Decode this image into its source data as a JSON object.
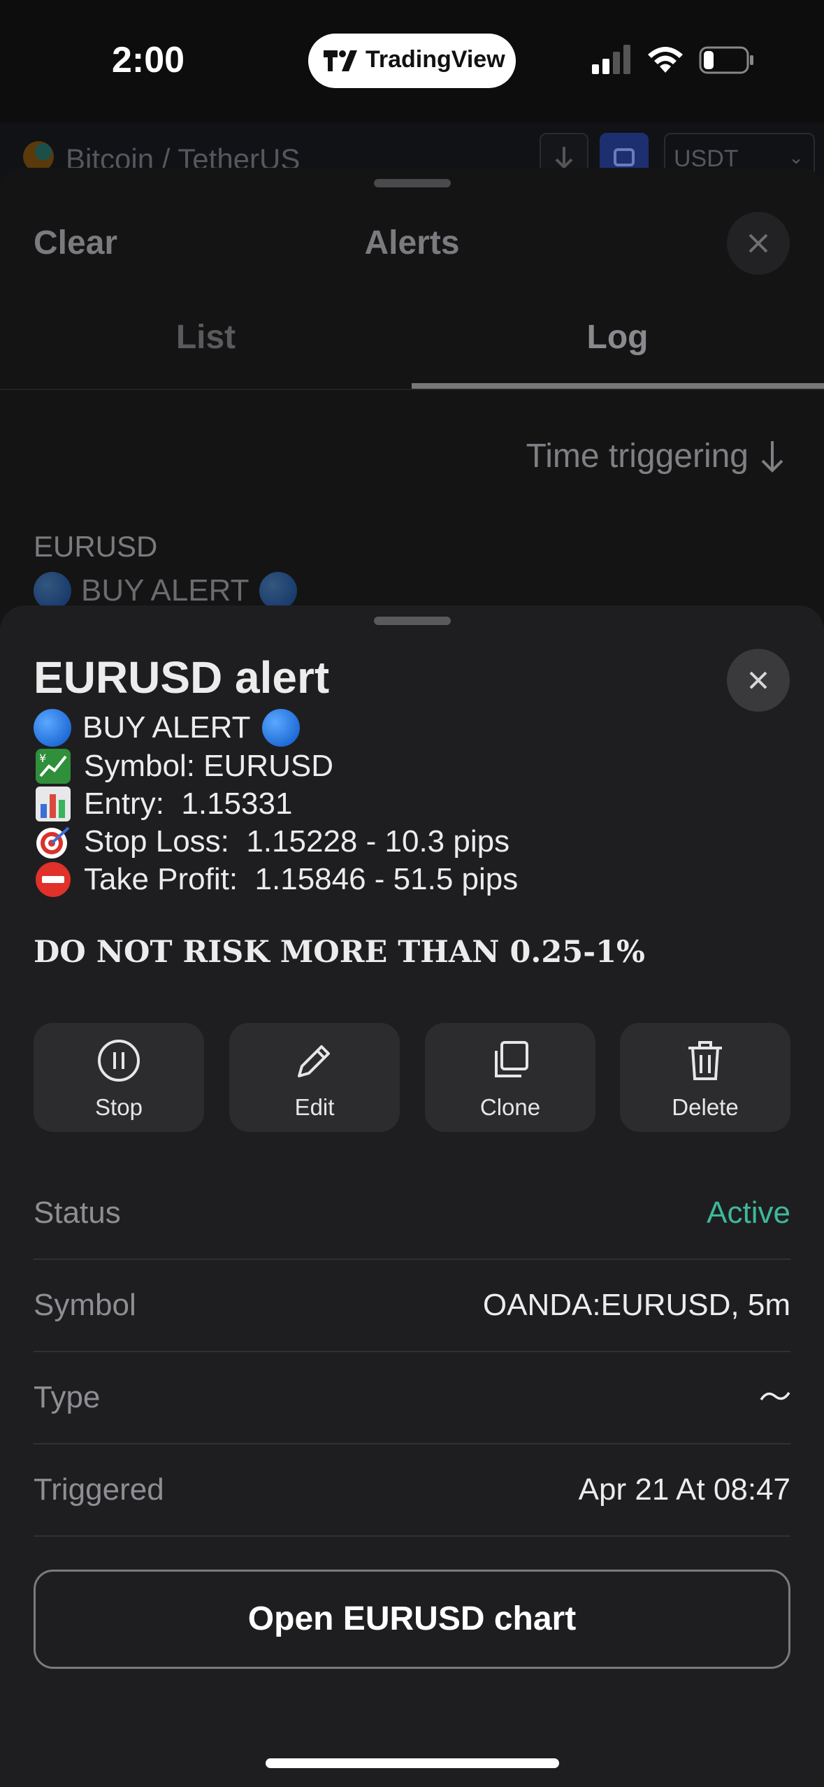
{
  "status_bar": {
    "time": "2:00",
    "app_pill": "TradingView"
  },
  "app_header": {
    "symbol": "Bitcoin / TetherUS",
    "currency": "USDT"
  },
  "alerts": {
    "clear_label": "Clear",
    "title": "Alerts",
    "tabs": [
      {
        "label": "List"
      },
      {
        "label": "Log"
      }
    ],
    "active_tab": "Log",
    "sort_label": "Time triggering",
    "log_entry": {
      "symbol": "EURUSD",
      "message": "BUY ALERT"
    }
  },
  "detail": {
    "title": "EURUSD alert",
    "message_lines": [
      "BUY ALERT",
      "Symbol: EURUSD",
      "Entry:  1.15331",
      "Stop Loss:  1.15228 - 10.3 pips",
      "Take Profit:  1.15846 - 51.5 pips"
    ],
    "warning": "DO NOT RISK MORE THAN 0.25-1%",
    "actions": [
      {
        "label": "Stop",
        "icon": "pause-icon"
      },
      {
        "label": "Edit",
        "icon": "pencil-icon"
      },
      {
        "label": "Clone",
        "icon": "copy-icon"
      },
      {
        "label": "Delete",
        "icon": "trash-icon"
      }
    ],
    "fields": [
      {
        "label": "Status",
        "value": "Active"
      },
      {
        "label": "Symbol",
        "value": "OANDA:EURUSD, 5m"
      },
      {
        "label": "Type",
        "value": ""
      },
      {
        "label": "Triggered",
        "value": "Apr 21 At 08:47"
      }
    ],
    "status_color": "#3fb89a",
    "open_chart_label": "Open EURUSD chart"
  }
}
